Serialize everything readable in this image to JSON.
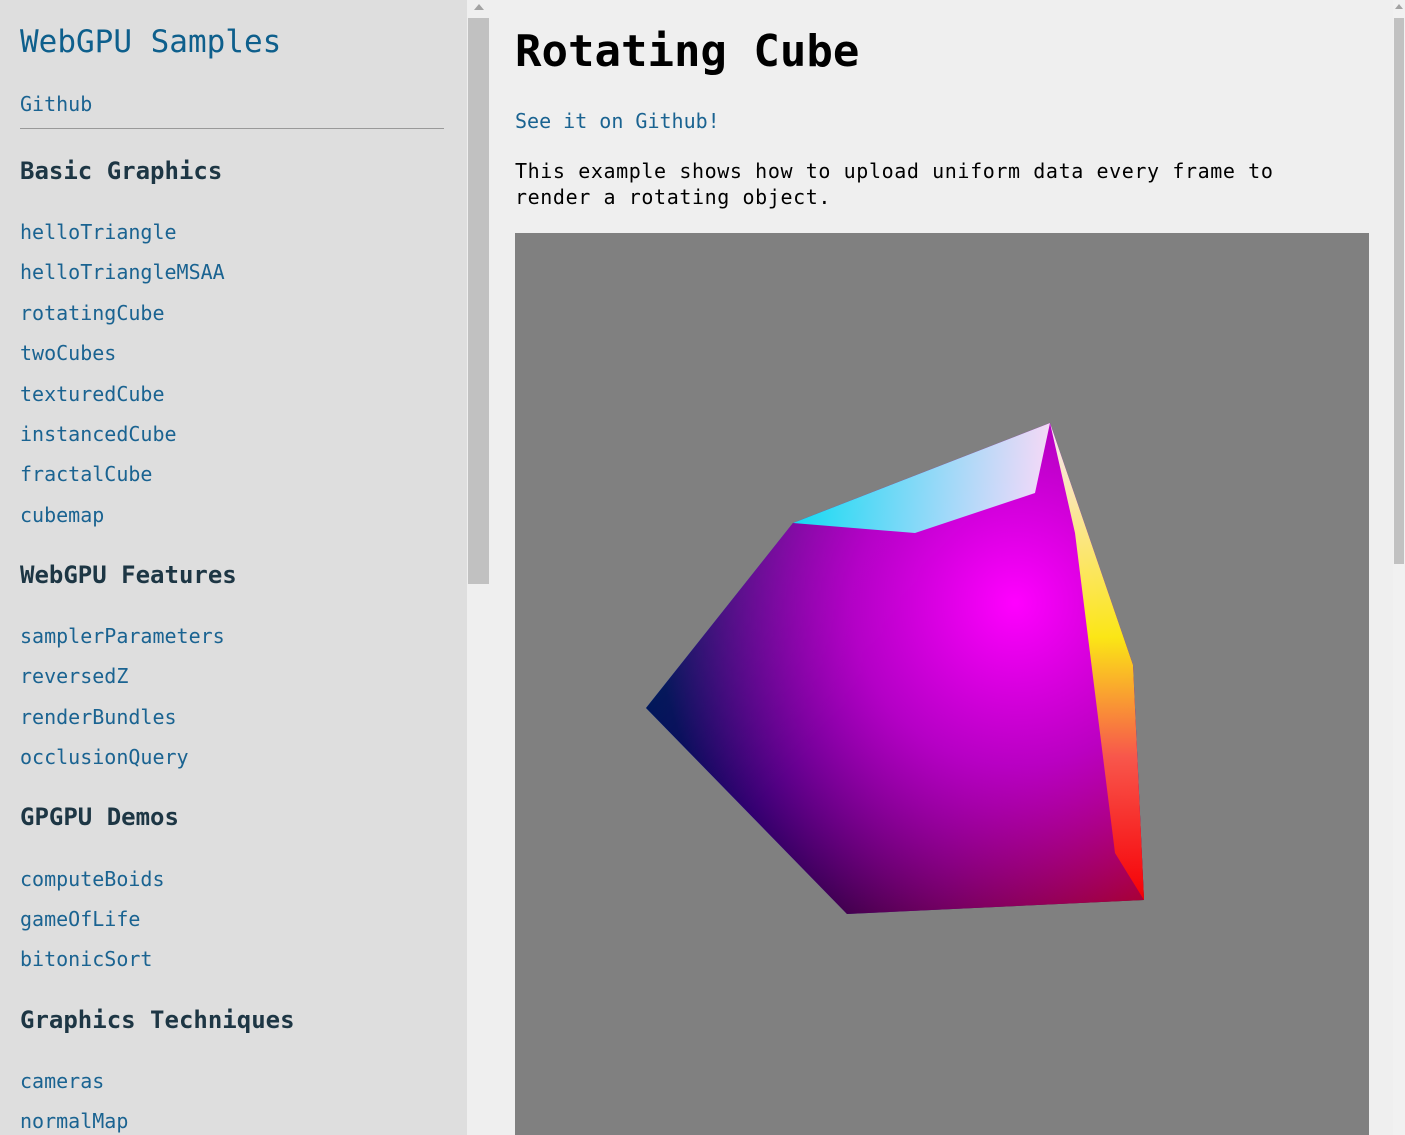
{
  "sidebar": {
    "title": "WebGPU Samples",
    "github_label": "Github",
    "sections": [
      {
        "title": "Basic Graphics",
        "items": [
          "helloTriangle",
          "helloTriangleMSAA",
          "rotatingCube",
          "twoCubes",
          "texturedCube",
          "instancedCube",
          "fractalCube",
          "cubemap"
        ]
      },
      {
        "title": "WebGPU Features",
        "items": [
          "samplerParameters",
          "reversedZ",
          "renderBundles",
          "occlusionQuery"
        ]
      },
      {
        "title": "GPGPU Demos",
        "items": [
          "computeBoids",
          "gameOfLife",
          "bitonicSort"
        ]
      },
      {
        "title": "Graphics Techniques",
        "items": [
          "cameras",
          "normalMap"
        ]
      }
    ]
  },
  "main": {
    "title": "Rotating Cube",
    "github_link": "See it on Github!",
    "description": "This example shows how to upload uniform data every frame to render a rotating object."
  },
  "colors": {
    "link": "#1a6391",
    "sidebar_bg": "#dedede",
    "main_bg": "#efefef",
    "canvas_bg": "#808080"
  }
}
